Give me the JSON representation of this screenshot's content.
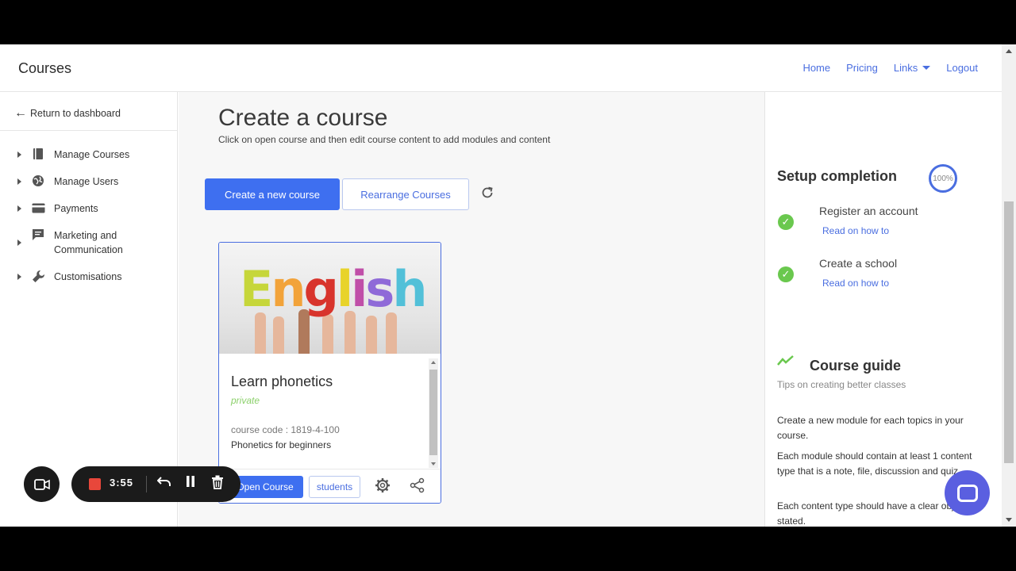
{
  "app": {
    "brand": "Courses"
  },
  "nav": {
    "home": "Home",
    "pricing": "Pricing",
    "links": "Links",
    "logout": "Logout"
  },
  "sidebar": {
    "return_label": "Return to dashboard",
    "items": [
      {
        "label": "Manage Courses",
        "icon": "book-icon"
      },
      {
        "label": "Manage Users",
        "icon": "globe-icon"
      },
      {
        "label": "Payments",
        "icon": "credit-card-icon"
      },
      {
        "label": "Marketing and Communication",
        "icon": "message-icon"
      },
      {
        "label": "Customisations",
        "icon": "wrench-icon"
      }
    ]
  },
  "main": {
    "title": "Create a course",
    "subtitle": "Click on open course and then edit course content to add modules and content",
    "create_button": "Create a new course",
    "rearrange_button": "Rearrange Courses"
  },
  "course_card": {
    "image_text": "English",
    "title": "Learn phonetics",
    "visibility": "private",
    "code": "course code : 1819-4-100",
    "description": "Phonetics for beginners",
    "open_button": "Open Course",
    "students_button": "students"
  },
  "setup": {
    "title": "Setup completion",
    "progress": "100%",
    "steps": [
      {
        "label": "Register an account",
        "link": "Read on how to",
        "done": true
      },
      {
        "label": "Create a school",
        "link": "Read on how to",
        "done": true
      }
    ]
  },
  "guide": {
    "title": "Course guide",
    "subtitle": "Tips on creating better classes",
    "tips": [
      "Create a new module for each topics in your course.",
      "Each module should contain at least 1 content type that is a note, file, discussion and quiz.",
      "Each content type should have a clear objective stated."
    ]
  },
  "recorder": {
    "time": "3:55"
  },
  "colors": {
    "accent": "#3e6ff0",
    "success": "#6ac84e",
    "chat": "#5a5fe0",
    "record": "#e8473b"
  }
}
